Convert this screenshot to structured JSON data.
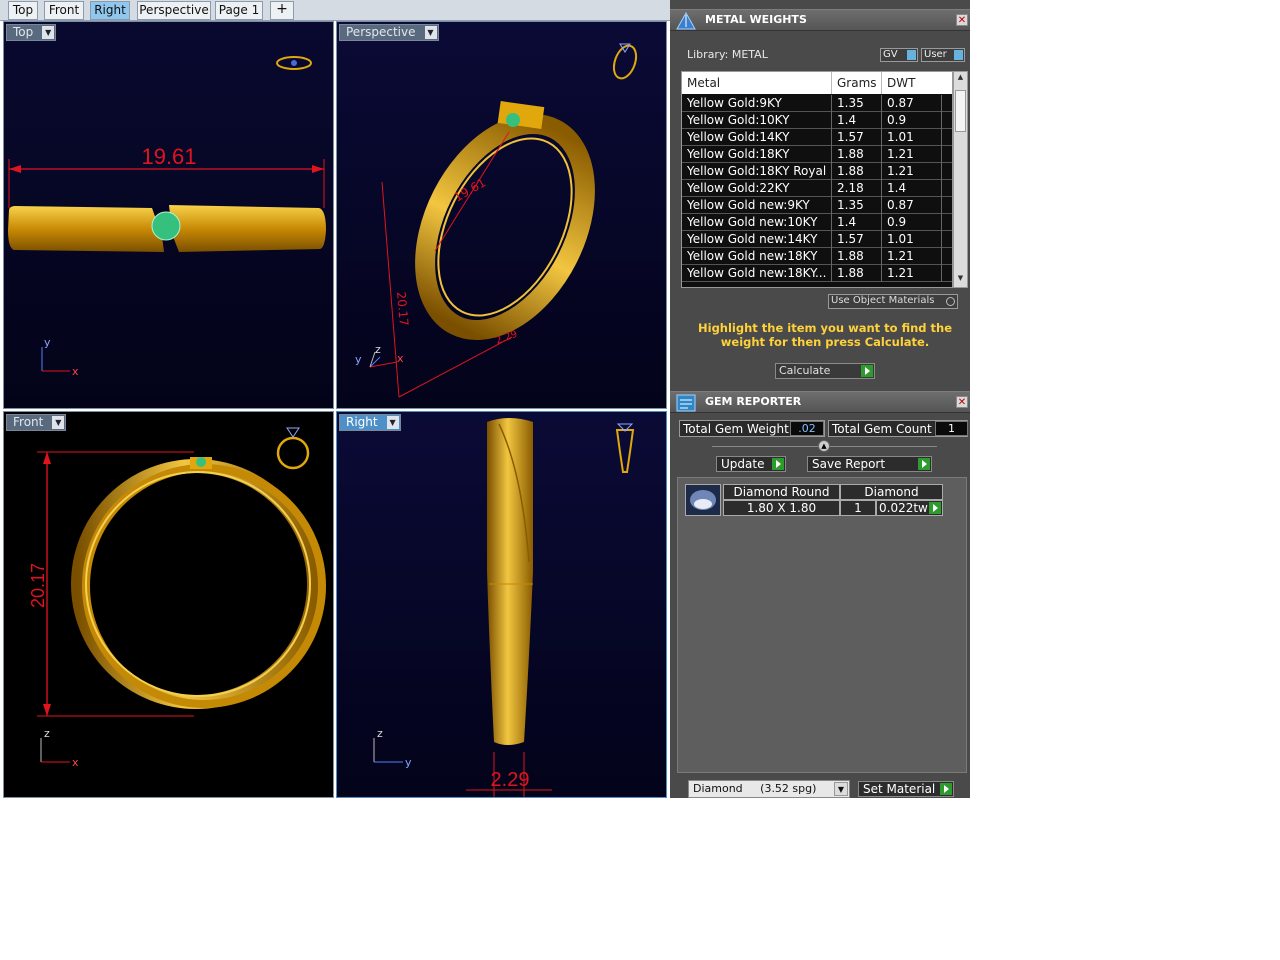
{
  "tabs": [
    {
      "label": "Top",
      "active": false
    },
    {
      "label": "Front",
      "active": false
    },
    {
      "label": "Right",
      "active": true
    },
    {
      "label": "Perspective",
      "active": false
    },
    {
      "label": "Page 1",
      "active": false
    },
    {
      "label": "+",
      "active": false
    }
  ],
  "viewports": {
    "top": {
      "label": "Top",
      "dimension": "19.61",
      "axis_v": "y",
      "axis_h": "x"
    },
    "perspective": {
      "label": "Perspective",
      "dimension_a": "19.61",
      "dimension_b": "20.17",
      "dimension_c": "2.29",
      "axis_y": "y",
      "axis_z": "z",
      "axis_x": "x"
    },
    "front": {
      "label": "Front",
      "dimension": "20.17",
      "axis_v": "z",
      "axis_h": "x"
    },
    "right": {
      "label": "Right",
      "dimension": "2.29",
      "axis_v": "z",
      "axis_h": "y"
    }
  },
  "metal_weights": {
    "title": "METAL WEIGHTS",
    "library": "Library: METAL",
    "toggle_gv": "GV",
    "toggle_user": "User",
    "columns": [
      "Metal",
      "Grams",
      "DWT"
    ],
    "rows": [
      [
        "Yellow Gold:9KY",
        "1.35",
        "0.87"
      ],
      [
        "Yellow Gold:10KY",
        "1.4",
        "0.9"
      ],
      [
        "Yellow Gold:14KY",
        "1.57",
        "1.01"
      ],
      [
        "Yellow Gold:18KY",
        "1.88",
        "1.21"
      ],
      [
        "Yellow Gold:18KY Royal",
        "1.88",
        "1.21"
      ],
      [
        "Yellow Gold:22KY",
        "2.18",
        "1.4"
      ],
      [
        "Yellow Gold new:9KY",
        "1.35",
        "0.87"
      ],
      [
        "Yellow Gold new:10KY",
        "1.4",
        "0.9"
      ],
      [
        "Yellow Gold new:14KY",
        "1.57",
        "1.01"
      ],
      [
        "Yellow Gold new:18KY",
        "1.88",
        "1.21"
      ],
      [
        "Yellow Gold new:18KY...",
        "1.88",
        "1.21"
      ]
    ],
    "use_object_materials": "Use Object Materials",
    "instruction": "Highlight the item you want to find the weight for then press Calculate.",
    "calculate": "Calculate"
  },
  "gem_reporter": {
    "title": "GEM REPORTER",
    "total_weight_label": "Total Gem Weight",
    "total_weight_value": ".02",
    "total_count_label": "Total Gem Count",
    "total_count_value": "1",
    "update": "Update",
    "save_report": "Save Report",
    "gem": {
      "shape": "Diamond Round",
      "material": "Diamond",
      "size": "1.80 X 1.80",
      "qty": "1",
      "weight": "0.022tw"
    },
    "material_select": "Diamond     (3.52 spg)",
    "set_material": "Set Material"
  },
  "colors": {
    "viewport_bg": "#0b0b2e",
    "gold": "#e0a80c",
    "dimension": "#e0141e",
    "panel_bg": "#4a4a4a",
    "accent": "#ffd23a"
  }
}
